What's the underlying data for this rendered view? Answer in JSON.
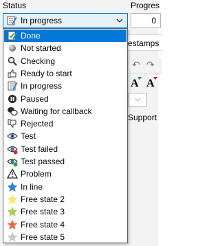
{
  "header": {
    "status_label": "Status",
    "progress_label": "Progres",
    "progress_value": "0"
  },
  "combo": {
    "value": "In progress",
    "icon": "in-progress-icon"
  },
  "dropdown": {
    "items": [
      {
        "label": "Done",
        "icon": "done-checklist-icon",
        "selected": true
      },
      {
        "label": "Not started",
        "icon": "gray-circle-icon"
      },
      {
        "label": "Checking",
        "icon": "magnifier-icon"
      },
      {
        "label": "Ready to start",
        "icon": "thumbs-up-icon"
      },
      {
        "label": "In progress",
        "icon": "in-progress-icon"
      },
      {
        "label": "Paused",
        "icon": "pause-icon"
      },
      {
        "label": "Waiting for callback",
        "icon": "speech-bubbles-icon"
      },
      {
        "label": "Rejected",
        "icon": "thumbs-down-icon"
      },
      {
        "label": "Test",
        "icon": "eye-icon"
      },
      {
        "label": "Test failed",
        "icon": "eye-red-icon"
      },
      {
        "label": "Test passed",
        "icon": "eye-green-icon"
      },
      {
        "label": "Problem",
        "icon": "warning-icon"
      },
      {
        "label": "In line",
        "icon": "blue-star-icon"
      },
      {
        "label": "Free state 2",
        "icon": "yellow-star-icon"
      },
      {
        "label": "Free state 3",
        "icon": "green-star-icon"
      },
      {
        "label": "Free state 4",
        "icon": "red-star-icon"
      },
      {
        "label": "Free state 5",
        "icon": "gray-star-icon"
      }
    ]
  },
  "background": {
    "tab_partial": "estamps",
    "support_partial": "Support"
  },
  "colors": {
    "selection": "#0078d7",
    "combo_bg": "#e5f1fb",
    "star_blue": "#2e7fd3",
    "star_yellow": "#f7ea6a",
    "star_green": "#a8cf52",
    "star_red": "#ee6a4f",
    "star_gray": "#c8c8c8"
  }
}
